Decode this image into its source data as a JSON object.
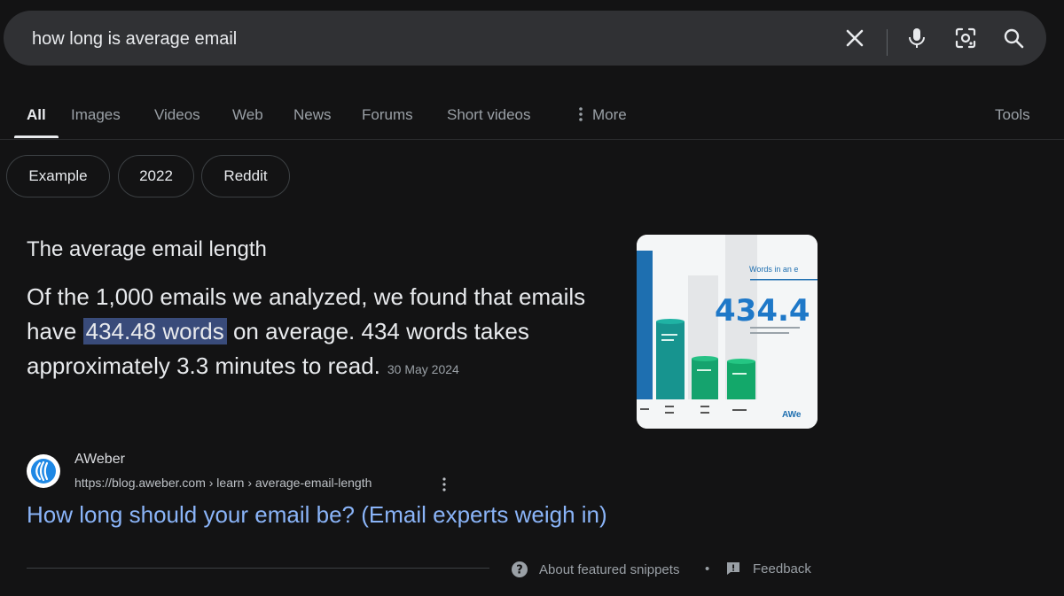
{
  "search": {
    "query": "how long is average email",
    "clear_icon": "close-icon",
    "voice_icon": "microphone-icon",
    "lens_icon": "camera-lens-icon",
    "search_icon": "search-icon"
  },
  "tabs": [
    {
      "label": "All",
      "active": true
    },
    {
      "label": "Images"
    },
    {
      "label": "Videos"
    },
    {
      "label": "Web"
    },
    {
      "label": "News"
    },
    {
      "label": "Forums"
    },
    {
      "label": "Short videos"
    },
    {
      "label": "More"
    }
  ],
  "tools_label": "Tools",
  "chips": [
    "Example",
    "2022",
    "Reddit"
  ],
  "snippet": {
    "title": "The average email length",
    "text_before": "Of the 1,000 emails we analyzed, we found that emails have ",
    "highlight": "434.48 words",
    "text_after": " on average. 434 words takes approximately 3.3 minutes to read.",
    "date": "30 May 2024"
  },
  "thumbnail": {
    "heading": "Words in an e",
    "big_number": "434.4",
    "brand": "AWe"
  },
  "source": {
    "name": "AWeber",
    "url": "https://blog.aweber.com › learn › average-email-length"
  },
  "result_title": "How long should your email be? (Email experts weigh in)",
  "footer": {
    "about": "About featured snippets",
    "feedback": "Feedback"
  },
  "colors": {
    "background": "#131314",
    "search_bg": "#303134",
    "link": "#8ab4f8",
    "highlight": "#394b7a"
  }
}
